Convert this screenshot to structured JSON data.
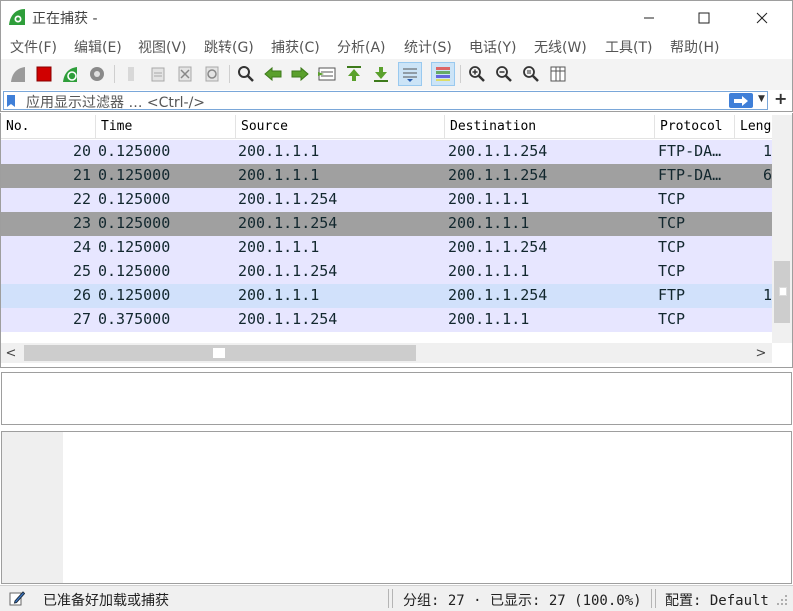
{
  "window": {
    "title": "正在捕获 -",
    "min_icon": "minimize-icon",
    "max_icon": "maximize-icon",
    "close_icon": "close-icon"
  },
  "menu": [
    "文件(F)",
    "编辑(E)",
    "视图(V)",
    "跳转(G)",
    "捕获(C)",
    "分析(A)",
    "统计(S)",
    "电话(Y)",
    "无线(W)",
    "工具(T)",
    "帮助(H)"
  ],
  "toolbar": [
    {
      "name": "start-capture-icon"
    },
    {
      "name": "stop-capture-icon"
    },
    {
      "name": "restart-capture-icon"
    },
    {
      "name": "capture-options-icon"
    },
    {
      "name": "open-file-icon"
    },
    {
      "name": "save-file-icon"
    },
    {
      "name": "close-file-icon"
    },
    {
      "name": "reload-file-icon"
    },
    {
      "name": "find-packet-icon"
    },
    {
      "name": "go-back-icon"
    },
    {
      "name": "go-forward-icon"
    },
    {
      "name": "go-to-packet-icon"
    },
    {
      "name": "go-to-first-icon"
    },
    {
      "name": "go-to-last-icon"
    },
    {
      "name": "auto-scroll-icon",
      "active": true
    },
    {
      "name": "colorize-icon",
      "active": true
    },
    {
      "name": "zoom-in-icon"
    },
    {
      "name": "zoom-out-icon"
    },
    {
      "name": "zoom-normal-icon"
    },
    {
      "name": "resize-columns-icon"
    }
  ],
  "filter": {
    "placeholder": "应用显示过滤器 … <Ctrl-/>",
    "apply_icon": "arrow-right-icon",
    "dropdown_icon": "chevron-down-icon",
    "add_label": "+"
  },
  "packet_list": {
    "columns": [
      "No.",
      "Time",
      "Source",
      "Destination",
      "Protocol",
      "Leng"
    ],
    "rows": [
      {
        "no": "20",
        "time": "0.125000",
        "source": "200.1.1.1",
        "destination": "200.1.1.254",
        "protocol": "FTP-DA…",
        "length": "1",
        "bg": "#e7e6ff"
      },
      {
        "no": "21",
        "time": "0.125000",
        "source": "200.1.1.1",
        "destination": "200.1.1.254",
        "protocol": "FTP-DA…",
        "length": "6",
        "bg": "#a0a0a0"
      },
      {
        "no": "22",
        "time": "0.125000",
        "source": "200.1.1.254",
        "destination": "200.1.1.1",
        "protocol": "TCP",
        "length": "",
        "bg": "#e7e6ff"
      },
      {
        "no": "23",
        "time": "0.125000",
        "source": "200.1.1.254",
        "destination": "200.1.1.1",
        "protocol": "TCP",
        "length": "",
        "bg": "#a0a0a0"
      },
      {
        "no": "24",
        "time": "0.125000",
        "source": "200.1.1.1",
        "destination": "200.1.1.254",
        "protocol": "TCP",
        "length": "",
        "bg": "#e7e6ff"
      },
      {
        "no": "25",
        "time": "0.125000",
        "source": "200.1.1.254",
        "destination": "200.1.1.1",
        "protocol": "TCP",
        "length": "",
        "bg": "#e7e6ff"
      },
      {
        "no": "26",
        "time": "0.125000",
        "source": "200.1.1.1",
        "destination": "200.1.1.254",
        "protocol": "FTP",
        "length": "1",
        "bg": "#d1e1fb"
      },
      {
        "no": "27",
        "time": "0.375000",
        "source": "200.1.1.254",
        "destination": "200.1.1.1",
        "protocol": "TCP",
        "length": "",
        "bg": "#e7e6ff"
      }
    ],
    "scroll_left_label": "<",
    "scroll_right_label": ">"
  },
  "status": {
    "ready_text": "已准备好加载或捕获",
    "packets_text": "分组: 27 · 已显示: 27 (100.0%)",
    "profile_text": "配置: Default"
  },
  "colors": {
    "row_normal": "#e7e6ff",
    "row_gray": "#a0a0a0",
    "row_ftp": "#d1e1fb",
    "accent": "#3f7fd8"
  }
}
